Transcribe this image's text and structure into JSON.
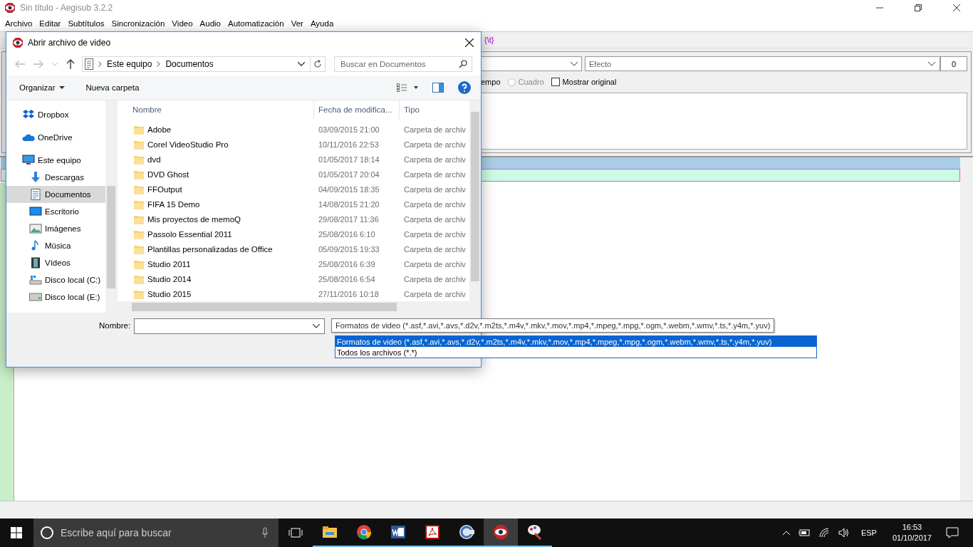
{
  "window": {
    "title": "Sin título - Aegisub 3.2.2"
  },
  "menu": [
    "Archivo",
    "Editar",
    "Subtítulos",
    "Sincronización",
    "Video",
    "Audio",
    "Automatización",
    "Ver",
    "Ayuda"
  ],
  "toolbar": {
    "tag": "{\\t}"
  },
  "editor": {
    "effect_placeholder": "Efecto",
    "layer": "0",
    "time_label": "empo",
    "frame_radio": {
      "label": "Cuadro",
      "disabled": true,
      "selected": false
    },
    "show_original": {
      "label": "Mostrar original",
      "checked": false
    }
  },
  "dialog": {
    "title": "Abrir archivo de video",
    "path": [
      "Este equipo",
      "Documentos"
    ],
    "search_placeholder": "Buscar en Documentos",
    "commands": [
      "Organizar",
      "Nueva carpeta"
    ],
    "sidebar": [
      {
        "label": "Dropbox",
        "kind": "dropbox",
        "selected": false
      },
      {
        "label": "OneDrive",
        "kind": "cloud",
        "selected": false
      },
      {
        "label": "Este equipo",
        "kind": "pc",
        "selected": false,
        "children": [
          {
            "label": "Descargas",
            "kind": "download",
            "selected": false
          },
          {
            "label": "Documentos",
            "kind": "document",
            "selected": true
          },
          {
            "label": "Escritorio",
            "kind": "desktop",
            "selected": false
          },
          {
            "label": "Imágenes",
            "kind": "pictures",
            "selected": false
          },
          {
            "label": "Música",
            "kind": "music",
            "selected": false
          },
          {
            "label": "Vídeos",
            "kind": "videos",
            "selected": false
          },
          {
            "label": "Disco local (C:)",
            "kind": "system-drive",
            "selected": false
          },
          {
            "label": "Disco local (E:)",
            "kind": "drive",
            "selected": false
          }
        ]
      }
    ],
    "columns": [
      "Nombre",
      "Fecha de modifica...",
      "Tipo"
    ],
    "rows": [
      {
        "name": "Adobe",
        "date": "03/09/2015 21:00",
        "type": "Carpeta de archiv"
      },
      {
        "name": "Corel VideoStudio Pro",
        "date": "10/11/2016 22:53",
        "type": "Carpeta de archiv"
      },
      {
        "name": "dvd",
        "date": "01/05/2017 18:14",
        "type": "Carpeta de archiv"
      },
      {
        "name": "DVD Ghost",
        "date": "01/05/2017 20:04",
        "type": "Carpeta de archiv"
      },
      {
        "name": "FFOutput",
        "date": "04/09/2015 18:35",
        "type": "Carpeta de archiv"
      },
      {
        "name": "FIFA 15 Demo",
        "date": "14/08/2015 21:20",
        "type": "Carpeta de archiv"
      },
      {
        "name": "Mis proyectos de memoQ",
        "date": "29/08/2017 11:36",
        "type": "Carpeta de archiv"
      },
      {
        "name": "Passolo Essential 2011",
        "date": "25/08/2016 6:10",
        "type": "Carpeta de archiv"
      },
      {
        "name": "Plantillas personalizadas de Office",
        "date": "05/09/2015 19:33",
        "type": "Carpeta de archiv"
      },
      {
        "name": "Studio 2011",
        "date": "25/08/2016 6:39",
        "type": "Carpeta de archiv"
      },
      {
        "name": "Studio 2014",
        "date": "25/08/2016 6:54",
        "type": "Carpeta de archiv"
      },
      {
        "name": "Studio 2015",
        "date": "27/11/2016 10:18",
        "type": "Carpeta de archiv"
      }
    ],
    "filename_label": "Nombre:",
    "filter": "Formatos de video (*.asf,*.avi,*.avs,*.d2v,*.m2ts,*.m4v,*.mkv,*.mov,*.mp4,*.mpeg,*.mpg,*.ogm,*.webm,*.wmv,*.ts,*.y4m,*.yuv)",
    "filter_options": [
      {
        "label": "Formatos de video (*.asf,*.avi,*.avs,*.d2v,*.m2ts,*.m4v,*.mkv,*.mov,*.mp4,*.mpeg,*.mpg,*.ogm,*.webm,*.wmv,*.ts,*.y4m,*.yuv)",
        "selected": true
      },
      {
        "label": "Todos los archivos (*.*)",
        "selected": false
      }
    ]
  },
  "taskbar": {
    "search_placeholder": "Escribe aquí para buscar",
    "apps": [
      {
        "kind": "explorer",
        "active": false
      },
      {
        "kind": "chrome",
        "active": false
      },
      {
        "kind": "word",
        "active": false
      },
      {
        "kind": "acrobat",
        "active": false
      },
      {
        "kind": "ccleaner",
        "active": false
      },
      {
        "kind": "aegisub",
        "active": true
      },
      {
        "kind": "paint",
        "active": false
      }
    ],
    "language": "ESP",
    "time": "16:53",
    "date": "01/10/2017"
  }
}
